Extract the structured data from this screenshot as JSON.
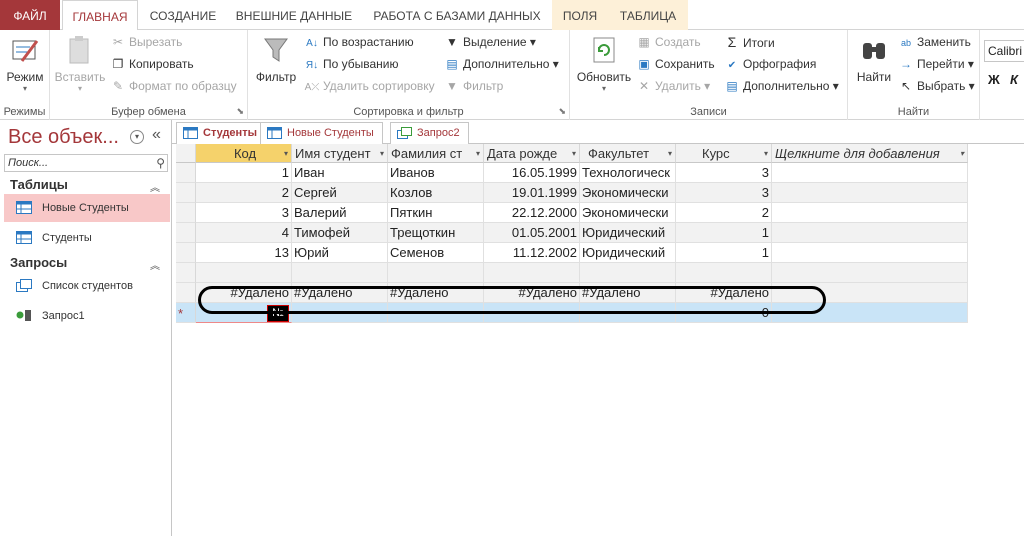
{
  "tabs": {
    "file": "ФАЙЛ",
    "home": "ГЛАВНАЯ",
    "create": "СОЗДАНИЕ",
    "external": "ВНЕШНИЕ ДАННЫЕ",
    "database": "РАБОТА С БАЗАМИ ДАННЫХ",
    "fields": "ПОЛЯ",
    "table": "ТАБЛИЦА"
  },
  "ribbon": {
    "views": {
      "view": "Режим",
      "group": "Режимы"
    },
    "clipboard": {
      "paste": "Вставить",
      "cut": "Вырезать",
      "copy": "Копировать",
      "format": "Формат по образцу",
      "group": "Буфер обмена"
    },
    "sort": {
      "filter": "Фильтр",
      "asc": "По возрастанию",
      "desc": "По убыванию",
      "remove": "Удалить сортировку",
      "selection": "Выделение",
      "advanced": "Дополнительно",
      "toggle": "Фильтр",
      "group": "Сортировка и фильтр"
    },
    "records": {
      "refresh": "Обновить",
      "new": "Создать",
      "save": "Сохранить",
      "delete": "Удалить",
      "totals": "Итоги",
      "spelling": "Орфография",
      "more": "Дополнительно",
      "group": "Записи"
    },
    "find": {
      "find": "Найти",
      "replace": "Заменить",
      "goto": "Перейти",
      "select": "Выбрать",
      "group": "Найти"
    },
    "font": {
      "name": "Calibri",
      "bold": "Ж",
      "italic": "К"
    }
  },
  "nav": {
    "title": "Все объек...",
    "search_placeholder": "Поиск...",
    "sec_tables": "Таблицы",
    "sec_queries": "Запросы",
    "items": {
      "new_students": "Новые Студенты",
      "students": "Студенты",
      "list": "Список студентов",
      "query1": "Запрос1"
    }
  },
  "doc_tabs": {
    "students": "Студенты",
    "new_students": "Новые Студенты",
    "query2": "Запрос2"
  },
  "table": {
    "headers": {
      "code": "Код",
      "first": "Имя студент",
      "last": "Фамилия ст",
      "dob": "Дата рожде",
      "faculty": "Факультет",
      "course": "Курс",
      "add": "Щелкните для добавления"
    },
    "rows": [
      {
        "code": "1",
        "first": "Иван",
        "last": "Иванов",
        "dob": "16.05.1999",
        "faculty": "Технологическ",
        "course": "3"
      },
      {
        "code": "2",
        "first": "Сергей",
        "last": "Козлов",
        "dob": "19.01.1999",
        "faculty": "Экономически",
        "course": "3"
      },
      {
        "code": "3",
        "first": "Валерий",
        "last": "Пяткин",
        "dob": "22.12.2000",
        "faculty": "Экономически",
        "course": "2"
      },
      {
        "code": "4",
        "first": "Тимофей",
        "last": "Трещоткин",
        "dob": "01.05.2001",
        "faculty": "Юридический",
        "course": "1"
      },
      {
        "code": "13",
        "first": "Юрий",
        "last": "Семенов",
        "dob": "11.12.2002",
        "faculty": "Юридический",
        "course": "1"
      }
    ],
    "deleted": "#Удалено",
    "new_marker": "№",
    "new_course": "0"
  }
}
